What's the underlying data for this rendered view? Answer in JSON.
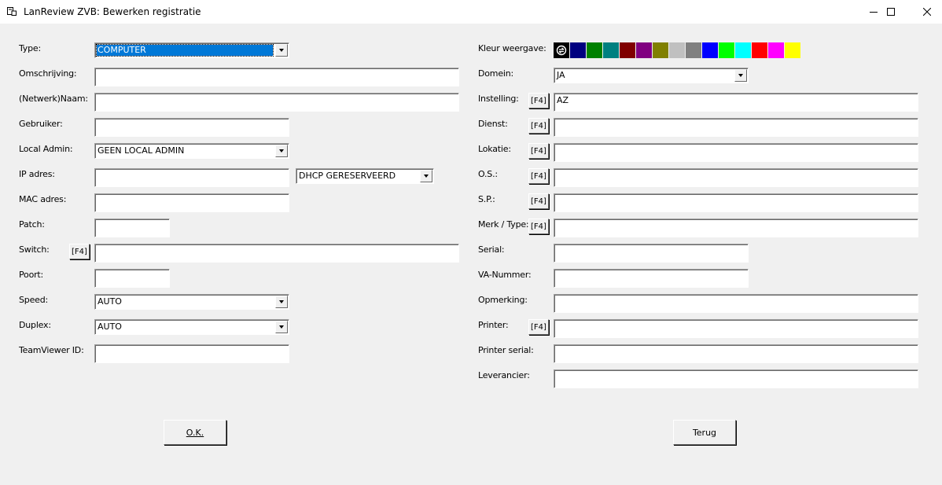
{
  "window": {
    "title": "LanReview ZVB: Bewerken registratie"
  },
  "left": {
    "type": {
      "label": "Type:",
      "value": "COMPUTER"
    },
    "omschrijving": {
      "label": "Omschrijving:",
      "value": ""
    },
    "naam": {
      "label": "(Netwerk)Naam:",
      "value": ""
    },
    "gebruiker": {
      "label": "Gebruiker:",
      "value": ""
    },
    "local_admin": {
      "label": "Local Admin:",
      "value": "GEEN LOCAL ADMIN"
    },
    "ip": {
      "label": "IP adres:",
      "value": "",
      "dhcp_value": "DHCP GERESERVEERD"
    },
    "mac": {
      "label": "MAC adres:",
      "value": ""
    },
    "patch": {
      "label": "Patch:",
      "value": ""
    },
    "switch": {
      "label": "Switch:",
      "f4": "[F4]",
      "value": ""
    },
    "poort": {
      "label": "Poort:",
      "value": ""
    },
    "speed": {
      "label": "Speed:",
      "value": "AUTO"
    },
    "duplex": {
      "label": "Duplex:",
      "value": "AUTO"
    },
    "teamviewer": {
      "label": "TeamViewer ID:",
      "value": ""
    }
  },
  "right": {
    "kleur": {
      "label": "Kleur weergave:",
      "reset_icon": "color-reset-icon",
      "colors": [
        "#000080",
        "#008000",
        "#008080",
        "#800000",
        "#800080",
        "#808000",
        "#c0c0c0",
        "#808080",
        "#0000ff",
        "#00ff00",
        "#00ffff",
        "#ff0000",
        "#ff00ff",
        "#ffff00"
      ]
    },
    "domein": {
      "label": "Domein:",
      "value": "JA"
    },
    "instelling": {
      "label": "Instelling:",
      "f4": "[F4]",
      "value": "AZ"
    },
    "dienst": {
      "label": "Dienst:",
      "f4": "[F4]",
      "value": ""
    },
    "lokatie": {
      "label": "Lokatie:",
      "f4": "[F4]",
      "value": ""
    },
    "os": {
      "label": "O.S.:",
      "f4": "[F4]",
      "value": ""
    },
    "sp": {
      "label": "S.P.:",
      "f4": "[F4]",
      "value": ""
    },
    "merk": {
      "label": "Merk / Type:",
      "f4": "[F4]",
      "value": ""
    },
    "serial": {
      "label": "Serial:",
      "value": ""
    },
    "va": {
      "label": "VA-Nummer:",
      "value": ""
    },
    "opmerking": {
      "label": "Opmerking:",
      "value": ""
    },
    "printer": {
      "label": "Printer:",
      "f4": "[F4]",
      "value": ""
    },
    "printer_serial": {
      "label": "Printer serial:",
      "value": ""
    },
    "leverancier": {
      "label": "Leverancier:",
      "value": ""
    }
  },
  "buttons": {
    "ok": "O.K.",
    "terug": "Terug"
  }
}
